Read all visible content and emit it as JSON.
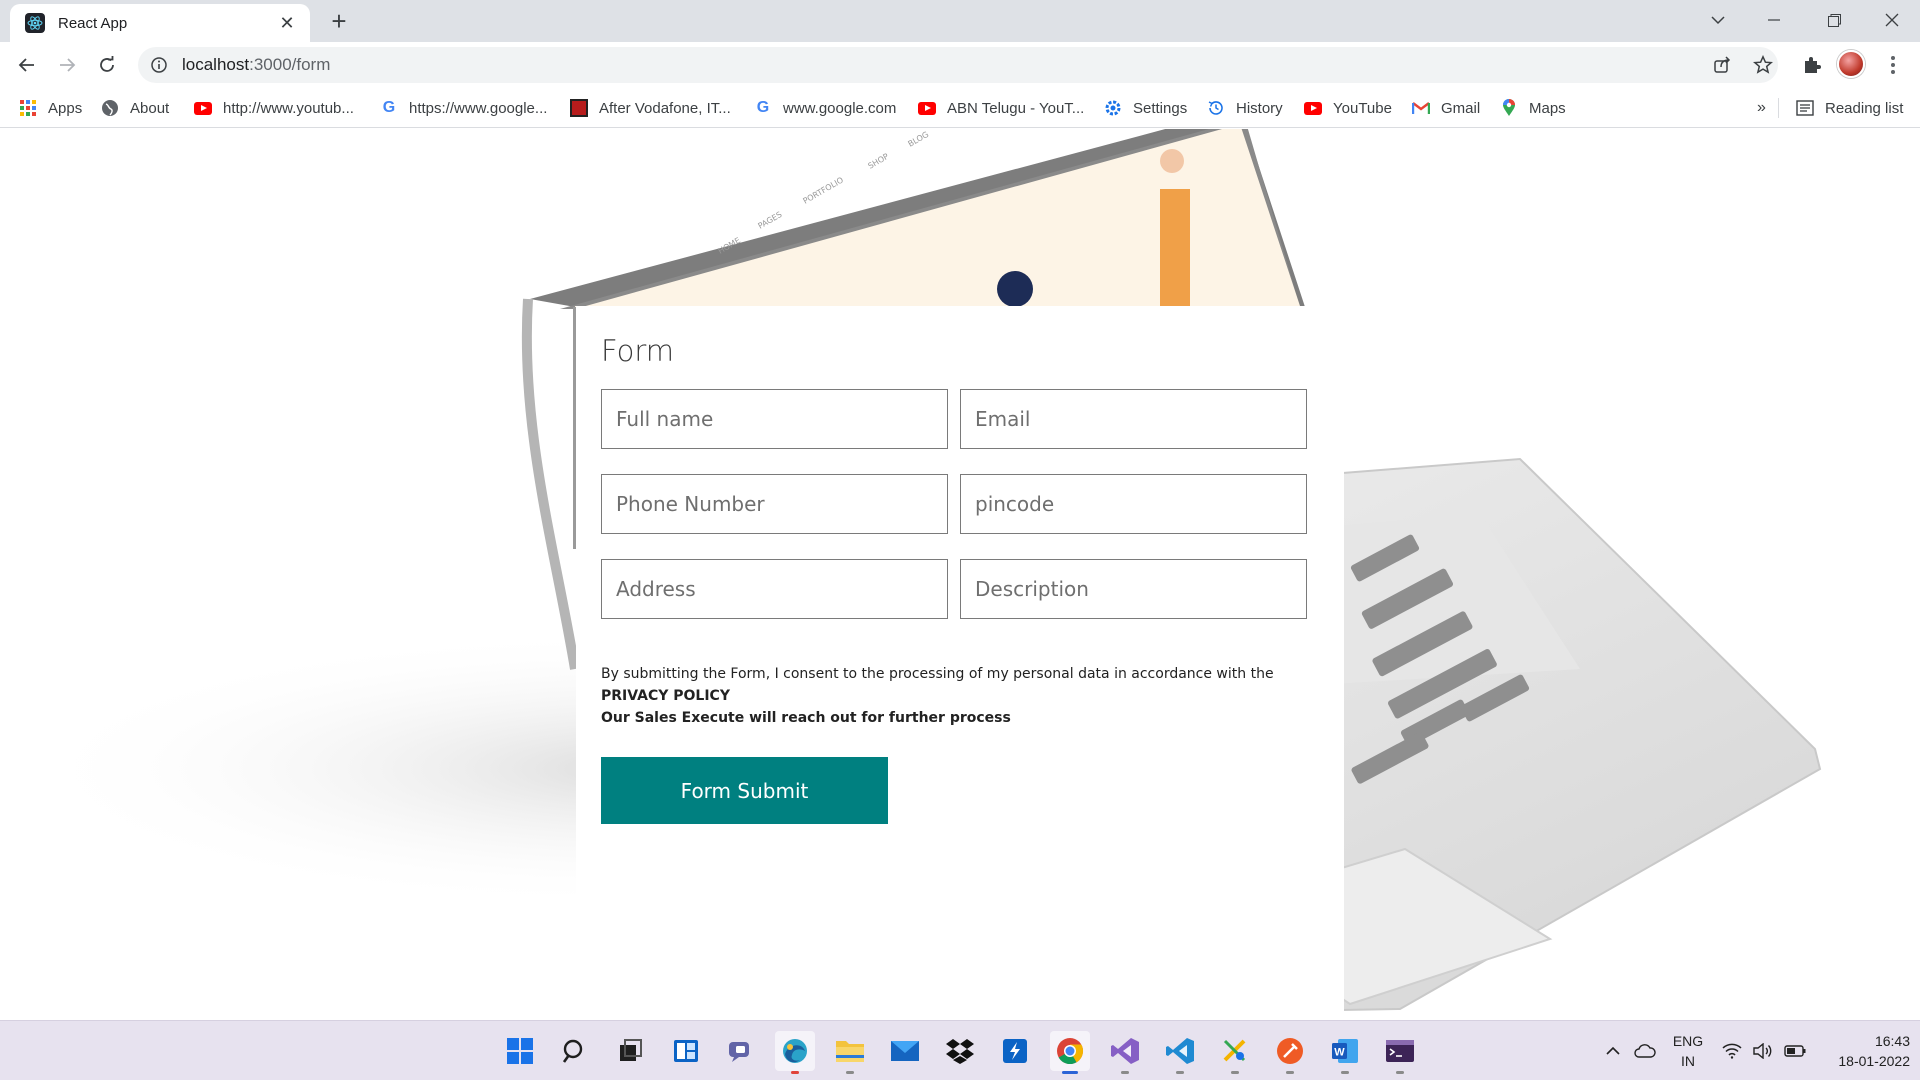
{
  "browser": {
    "tab_title": "React App",
    "url_host": "localhost",
    "url_path": ":3000/form",
    "bookmarks": [
      {
        "label": "Apps",
        "icon": "apps-grid-icon"
      },
      {
        "label": "About",
        "icon": "globe-icon"
      },
      {
        "label": "http://www.youtub...",
        "icon": "youtube-icon"
      },
      {
        "label": "https://www.google...",
        "icon": "google-icon"
      },
      {
        "label": "After Vodafone, IT...",
        "icon": "news-icon"
      },
      {
        "label": "www.google.com",
        "icon": "google-icon"
      },
      {
        "label": "ABN Telugu - YouT...",
        "icon": "youtube-icon"
      },
      {
        "label": "Settings",
        "icon": "gear-icon"
      },
      {
        "label": "History",
        "icon": "history-icon"
      },
      {
        "label": "YouTube",
        "icon": "youtube-icon"
      },
      {
        "label": "Gmail",
        "icon": "gmail-icon"
      },
      {
        "label": "Maps",
        "icon": "maps-pin-icon"
      }
    ],
    "overflow": "»",
    "reading_list": "Reading list"
  },
  "form": {
    "title": "Form",
    "placeholders": {
      "full_name": "Full name",
      "email": "Email",
      "phone": "Phone Number",
      "pincode": "pincode",
      "address": "Address",
      "description": "Description"
    },
    "consent_text": "By submitting the Form, I consent to the processing of my personal data in accordance with the ",
    "consent_policy": "PRIVACY POLICY",
    "sales_note": "Our Sales Execute will reach out for further process",
    "submit_label": "Form Submit",
    "accent_color": "#008080"
  },
  "taskbar": {
    "lang_line1": "ENG",
    "lang_line2": "IN",
    "time": "16:43",
    "date": "18-01-2022"
  }
}
